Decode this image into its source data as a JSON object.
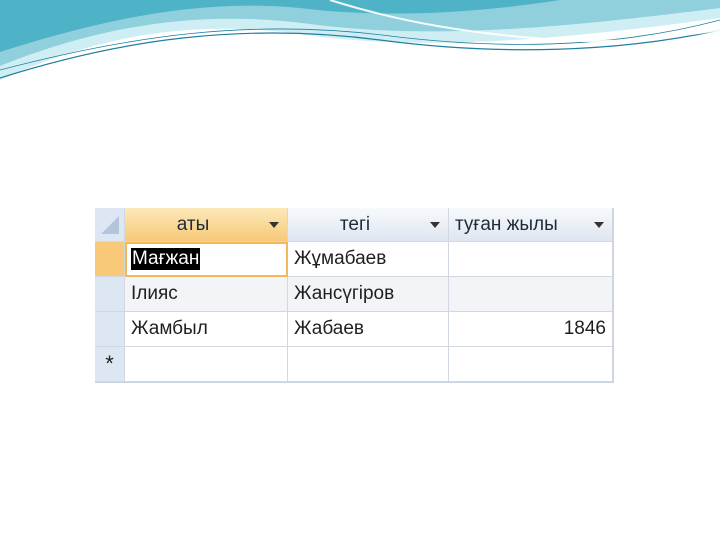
{
  "datasheet": {
    "columns": [
      {
        "label": "аты",
        "icon": "dropdown-arrow-icon"
      },
      {
        "label": "тегі",
        "icon": "dropdown-arrow-icon"
      },
      {
        "label": "туған жылы",
        "icon": "dropdown-arrow-icon"
      }
    ],
    "rows": [
      {
        "aty": "Мағжан",
        "tegi": "Жұмабаев",
        "tugan_zhyly": ""
      },
      {
        "aty": "Ілияс",
        "tegi": "Жансүгіров",
        "tugan_zhyly": ""
      },
      {
        "aty": "Жамбыл",
        "tegi": "Жабаев",
        "tugan_zhyly": "1846"
      }
    ],
    "new_record_marker": "*",
    "colors": {
      "active_header": "#f7c978",
      "header": "#dfe6f0",
      "selector": "#dde6f3",
      "grid_line": "#d2d8e2",
      "decor_wave": "#8fd0dc"
    }
  }
}
